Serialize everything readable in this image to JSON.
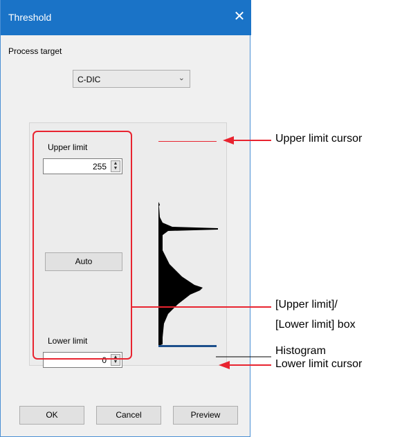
{
  "dialog": {
    "title": "Threshold",
    "close_glyph": "✕",
    "process_target_label": "Process target",
    "process_target_value": "C-DIC",
    "upper_limit_label": "Upper limit",
    "upper_limit_value": "255",
    "auto_label": "Auto",
    "lower_limit_label": "Lower limit",
    "lower_limit_value": "0",
    "buttons": {
      "ok": "OK",
      "cancel": "Cancel",
      "preview": "Preview"
    }
  },
  "annotations": {
    "upper_cursor": "Upper limit cursor",
    "box_line1": "[Upper limit]/",
    "box_line2": "[Lower limit] box",
    "histogram": "Histogram",
    "lower_cursor": "Lower limit cursor"
  },
  "colors": {
    "titlebar": "#1a73c7",
    "callout": "#e8232f"
  },
  "icons": {
    "close": "close-icon",
    "dropdown": "chevron-down-icon",
    "spin": "spin-arrows-icon"
  }
}
